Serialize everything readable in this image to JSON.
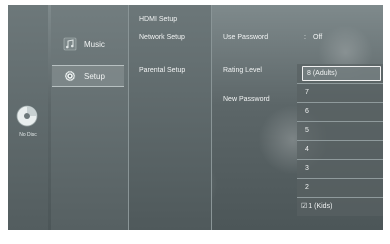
{
  "left_panel": {
    "disc_status": "No Disc"
  },
  "categories": [
    {
      "label": "Music",
      "icon": "music-note-icon"
    },
    {
      "label": "Setup",
      "icon": "gear-icon"
    }
  ],
  "submenu": [
    "HDMI Setup",
    "Network Setup",
    "Parental Setup"
  ],
  "settings": {
    "use_password": {
      "label": "Use Password",
      "value": "Off"
    },
    "rating_level": {
      "label": "Rating Level"
    },
    "new_password": {
      "label": "New Password"
    }
  },
  "rating_dropdown": {
    "selected": "8 (Adults)",
    "options": [
      "7",
      "6",
      "5",
      "4",
      "3",
      "2",
      "1 (Kids)"
    ],
    "checked_option": "1 (Kids)"
  },
  "colors": {
    "background": "#5c6668",
    "text": "#f2f4f4",
    "highlight_border": "#f0f0f0"
  }
}
